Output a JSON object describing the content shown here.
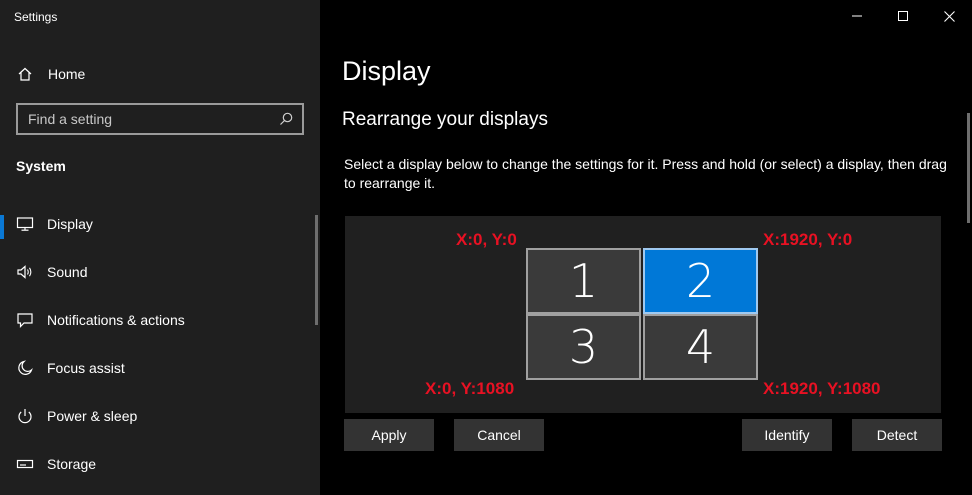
{
  "window": {
    "title": "Settings",
    "controls": [
      "minimize",
      "maximize",
      "close"
    ]
  },
  "sidebar": {
    "home_label": "Home",
    "search": {
      "placeholder": "Find a setting"
    },
    "section_title": "System",
    "items": [
      {
        "label": "Display",
        "icon": "monitor-icon",
        "active": true
      },
      {
        "label": "Sound",
        "icon": "speaker-icon",
        "active": false
      },
      {
        "label": "Notifications & actions",
        "icon": "message-icon",
        "active": false
      },
      {
        "label": "Focus assist",
        "icon": "moon-icon",
        "active": false
      },
      {
        "label": "Power & sleep",
        "icon": "power-icon",
        "active": false
      },
      {
        "label": "Storage",
        "icon": "storage-icon",
        "active": false
      }
    ]
  },
  "main": {
    "title": "Display",
    "subtitle": "Rearrange your displays",
    "description": "Select a display below to change the settings for it. Press and hold (or select) a display, then drag to rearrange it.",
    "monitors": [
      {
        "number": "1",
        "selected": false
      },
      {
        "number": "2",
        "selected": true
      },
      {
        "number": "3",
        "selected": false
      },
      {
        "number": "4",
        "selected": false
      }
    ],
    "annotations": {
      "top_left": "X:0, Y:0",
      "top_right": "X:1920, Y:0",
      "bottom_left": "X:0, Y:1080",
      "bottom_right": "X:1920, Y:1080"
    },
    "buttons": {
      "apply": "Apply",
      "cancel": "Cancel",
      "identify": "Identify",
      "detect": "Detect"
    }
  },
  "colors": {
    "sidebar_bg": "#1f1f1f",
    "main_bg": "#000000",
    "accent": "#0078d7",
    "annotation": "#e81123",
    "button_bg": "#333333"
  }
}
